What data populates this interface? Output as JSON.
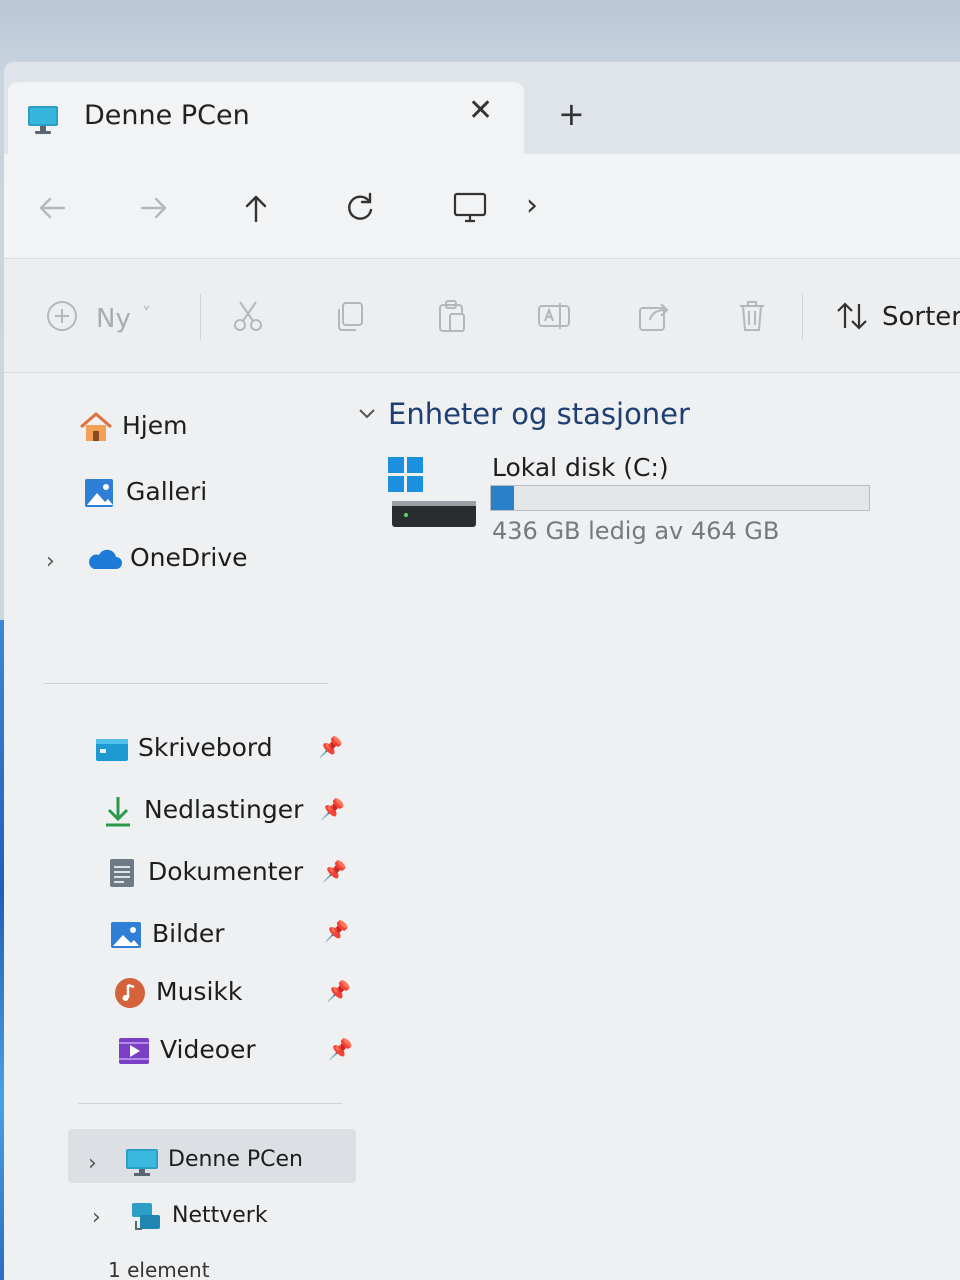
{
  "window": {
    "tab_title": "Denne PCen",
    "tab_close": "✕",
    "tab_new": "+"
  },
  "navbar": {
    "breadcrumb_chevron": "›",
    "icons": [
      "back-arrow-icon",
      "forward-arrow-icon",
      "up-arrow-icon",
      "refresh-icon",
      "this-pc-icon"
    ]
  },
  "commandbar": {
    "new_label": "Ny",
    "new_chevron": "˅",
    "sort_label": "Sorter",
    "icons": [
      "cut-icon",
      "copy-icon",
      "paste-icon",
      "rename-icon",
      "share-icon",
      "delete-icon",
      "sort-icon"
    ]
  },
  "sidebar": {
    "top_items": [
      {
        "label": "Hjem",
        "icon": "home-icon"
      },
      {
        "label": "Galleri",
        "icon": "gallery-icon"
      },
      {
        "label": "OneDrive",
        "icon": "onedrive-cloud-icon",
        "expandable": true
      }
    ],
    "pinned_items": [
      {
        "label": "Skrivebord",
        "icon": "desktop-folder-icon"
      },
      {
        "label": "Nedlastinger",
        "icon": "downloads-icon"
      },
      {
        "label": "Dokumenter",
        "icon": "documents-icon"
      },
      {
        "label": "Bilder",
        "icon": "pictures-icon"
      },
      {
        "label": "Musikk",
        "icon": "music-icon"
      },
      {
        "label": "Videoer",
        "icon": "videos-icon"
      }
    ],
    "bottom_items": [
      {
        "label": "Denne PCen",
        "icon": "this-pc-icon",
        "selected": true
      },
      {
        "label": "Nettverk",
        "icon": "network-icon"
      }
    ],
    "chevron": "›",
    "pin_glyph": "📌"
  },
  "main": {
    "group_title": "Enheter og stasjoner",
    "drive": {
      "name": "Lokal disk (C:)",
      "free_text": "436 GB ledig av 464 GB",
      "used_fraction": 0.06
    }
  },
  "statusbar": {
    "text": "1 element"
  },
  "colors": {
    "accent": "#2a80c8",
    "header_text": "#1e3f73"
  }
}
